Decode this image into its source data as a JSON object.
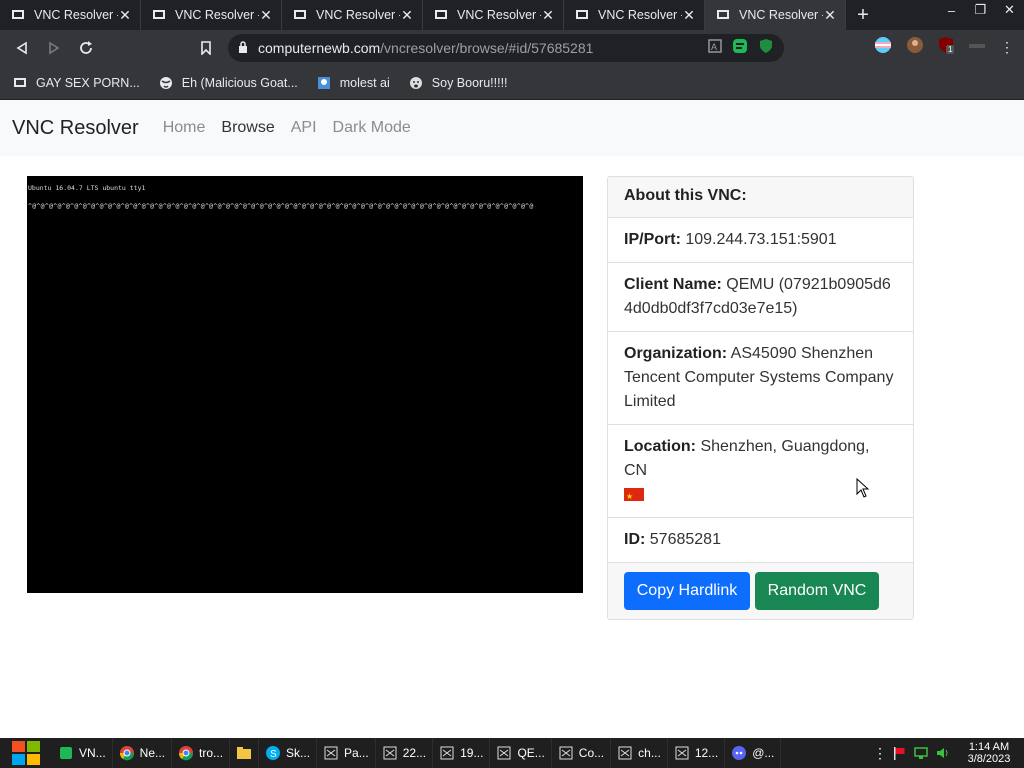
{
  "browser": {
    "tabs": [
      {
        "title": "VNC Resolver -"
      },
      {
        "title": "VNC Resolver -"
      },
      {
        "title": "VNC Resolver -"
      },
      {
        "title": "VNC Resolver -"
      },
      {
        "title": "VNC Resolver -"
      },
      {
        "title": "VNC Resolver -",
        "active": true
      }
    ],
    "url_host": "computernewb.com",
    "url_path": "/vncresolver/browse/#id/57685281",
    "bookmarks": [
      "GAY SEX PORN...",
      "Eh (Malicious Goat...",
      "molest ai",
      "Soy Booru!!!!!"
    ],
    "extension_badge": "1"
  },
  "site": {
    "brand": "VNC Resolver",
    "nav": [
      "Home",
      "Browse",
      "API",
      "Dark Mode"
    ],
    "active_nav": "Browse"
  },
  "screenshot": {
    "line1": "Ubuntu 16.04.7 LTS ubuntu tty1",
    "line2": "^@^@^@^@^@^@^@^@^@^@^@^@^@^@^@^@^@^@^@^@^@^@^@^@^@^@^@^@^@^@^@^@^@^@^@^@^@^@^@^@^@^@^@^@^@^@^@^@^@^@^@^@^@^@^@^@^@^@^@^@"
  },
  "about": {
    "header": "About this VNC:",
    "ip_label": "IP/Port:",
    "ip_value": "109.244.73.151:5901",
    "client_label": "Client Name:",
    "client_value": "QEMU (07921b0905d64d0db0df3f7cd03e7e15)",
    "org_label": "Organization:",
    "org_value": "AS45090 Shenzhen Tencent Computer Systems Company Limited",
    "loc_label": "Location:",
    "loc_value": "Shenzhen, Guangdong, CN",
    "id_label": "ID:",
    "id_value": "57685281",
    "copy_button": "Copy Hardlink",
    "random_button": "Random VNC"
  },
  "taskbar": {
    "items": [
      "VN...",
      "Ne...",
      "tro...",
      "",
      "Sk...",
      "Pa...",
      "22...",
      "19...",
      "QE...",
      "Co...",
      "ch...",
      "12...",
      "@..."
    ],
    "time": "1:14 AM",
    "date": "3/8/2023"
  },
  "colors": {
    "tab_bg": "#202124",
    "toolbar_bg": "#35363a",
    "primary": "#0d6efd",
    "success": "#198754"
  }
}
